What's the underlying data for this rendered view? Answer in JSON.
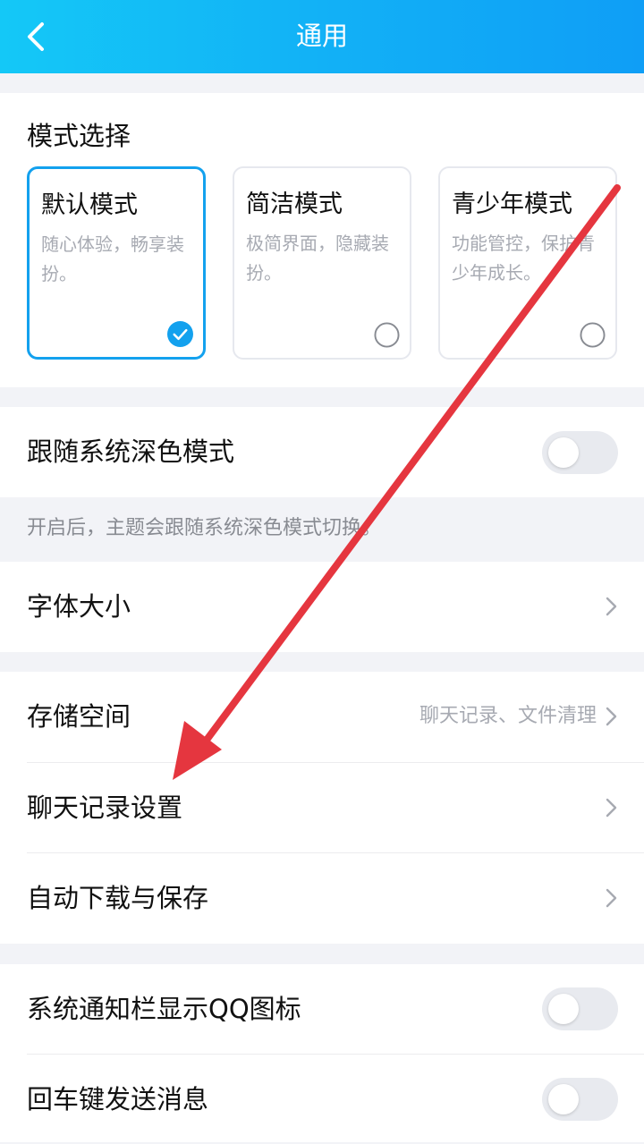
{
  "header": {
    "title": "通用",
    "back_icon": "chevron-left-icon"
  },
  "mode_section": {
    "label": "模式选择",
    "modes": [
      {
        "title": "默认模式",
        "desc": "随心体验，畅享装扮。",
        "selected": true
      },
      {
        "title": "简洁模式",
        "desc": "极简界面，隐藏装扮。",
        "selected": false
      },
      {
        "title": "青少年模式",
        "desc": "功能管控，保护青少年成长。",
        "selected": false
      }
    ]
  },
  "dark_mode": {
    "label": "跟随系统深色模式",
    "enabled": false,
    "hint": "开启后，主题会跟随系统深色模式切换。"
  },
  "font_size": {
    "label": "字体大小"
  },
  "storage_group": {
    "storage": {
      "label": "存储空间",
      "value": "聊天记录、文件清理"
    },
    "chat_history": {
      "label": "聊天记录设置"
    },
    "auto_download": {
      "label": "自动下载与保存"
    }
  },
  "notification_group": {
    "qq_icon": {
      "label": "系统通知栏显示QQ图标",
      "enabled": false
    },
    "enter_send": {
      "label": "回车键发送消息",
      "enabled": false
    }
  },
  "colors": {
    "header_gradient_start": "#14c8f7",
    "header_gradient_end": "#0f9ef6",
    "accent": "#13a1ee",
    "annotation_arrow": "#e5363f",
    "background": "#f2f3f7"
  }
}
